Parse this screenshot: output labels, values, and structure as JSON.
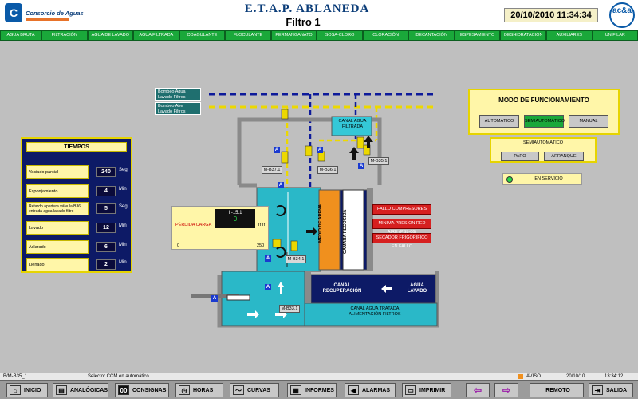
{
  "header": {
    "org_name": "Consorcio de Aguas",
    "plant_title": "E.T.A.P. ABLANEDA",
    "screen_title": "Filtro 1",
    "datetime": "20/10/2010 11:34:34",
    "logo_right": "ac&a"
  },
  "nav": [
    "AGUA BRUTA",
    "FILTRACIÓN",
    "AGUA DE LAVADO",
    "AGUA FILTRADA",
    "COAGULANTE",
    "FLOCULANTE",
    "PERMANGANATO",
    "SOSA-CLORO",
    "CLORACIÓN",
    "DECANTACIÓN",
    "ESPESAMIENTO",
    "DESHIDRATACIÓN",
    "AUXILIARES",
    "UNIFILAR"
  ],
  "tiempos": {
    "title": "TIEMPOS",
    "rows": [
      {
        "label": "Vaciado parcial",
        "value": "240",
        "unit": "Seg"
      },
      {
        "label": "Esponjamiento",
        "value": "4",
        "unit": "Min"
      },
      {
        "label": "Retardo apertura válvula B36 entrada agua lavado filtro",
        "value": "5",
        "unit": "Seg"
      },
      {
        "label": "Lavado",
        "value": "12",
        "unit": "Min"
      },
      {
        "label": "Aclarado",
        "value": "6",
        "unit": "Min"
      },
      {
        "label": "Llenado",
        "value": "2",
        "unit": "Min"
      }
    ]
  },
  "perdida": {
    "tag": "I -15.1",
    "label": "PÉRDIDA CARGA",
    "value": "0",
    "unit": "mm",
    "scale_min": "0",
    "scale_max": "250",
    "level": 0
  },
  "modo": {
    "title": "MODO DE FUNCIONAMIENTO",
    "buttons": [
      "AUTOMÁTICO",
      "SEMIAUTOMÁTICO",
      "MANUAL"
    ],
    "active": "SEMIAUTOMÁTICO",
    "semi_title": "SEMIAUTOMÁTICO",
    "semi_buttons": [
      "PARO",
      "ARRANQUE"
    ],
    "servicio": "EN SERVICIO"
  },
  "alarms": [
    "FALLO COMPRESORES",
    "MINIMA PRESION RED AIRE (PSL-06)",
    "SECADOR FRIGORIFICO EN FALLO"
  ],
  "process": {
    "bombeo_agua": "Bombeo Agua Lavado Filtros",
    "bombeo_aire": "Bombeo Aire Lavado Filtros",
    "canal_filtrada": "CANAL AGUA FILTRADA",
    "medio": "MEDIO DE ARENA",
    "camara": "CÁMARA RECOGIDA",
    "canal_recuperacion": "CANAL RECUPERACIÓN",
    "agua_lavado": "AGUA LAVADO",
    "canal_tratada": "CANAL AGUA TRATADA ALIMENTACIÓN FILTROS",
    "valves": [
      "M-B37.1",
      "M-B36.1",
      "M-B35.1",
      "M-B34.1",
      "M-B33.1"
    ],
    "a_label": "A"
  },
  "status": {
    "code": "B/M-B35_1",
    "message": "Selector CCM en automático",
    "aviso": "AVISO",
    "date": "20/10/10",
    "time": "13:34:12"
  },
  "toolbar": [
    "INICIO",
    "ANALÓGICAS",
    "CONSIGNAS",
    "HORAS",
    "CURVAS",
    "INFORMES",
    "ALARMAS",
    "IMPRIMIR",
    "REMOTO",
    "SALIDA"
  ],
  "colors": {
    "accent_green": "#1aa83a",
    "panel_yellow": "#fff6a8",
    "alarm_red": "#d62020",
    "water_cyan": "#2ab8c8",
    "navy": "#0d1a66",
    "sand": "#f0901e"
  }
}
